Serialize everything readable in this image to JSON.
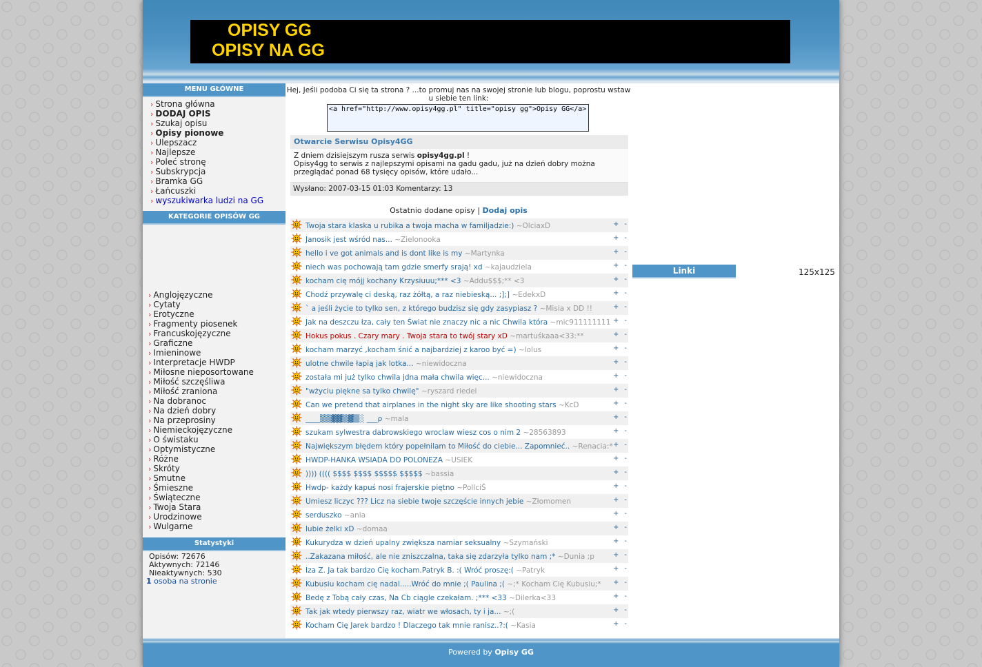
{
  "banner": {
    "line1": "OPISY GG",
    "line2": "OPISY NA GG"
  },
  "left": {
    "menu_title": "MENU GŁÓWNE",
    "menu": [
      {
        "label": "Strona główna",
        "style": ""
      },
      {
        "label": "DODAJ OPIS",
        "style": "bold"
      },
      {
        "label": "Szukaj opisu",
        "style": ""
      },
      {
        "label": "Opisy pionowe",
        "style": "bold"
      },
      {
        "label": "Ulepszacz",
        "style": ""
      },
      {
        "label": "Najlepsze",
        "style": ""
      },
      {
        "label": "Poleć stronę",
        "style": ""
      },
      {
        "label": "Subskrypcja",
        "style": ""
      },
      {
        "label": "Bramka GG",
        "style": ""
      },
      {
        "label": "Łańcuszki",
        "style": ""
      },
      {
        "label": "wyszukiwarka ludzi na GG",
        "style": "link"
      }
    ],
    "categories_title": "KATEGORIE OPISÓW GG",
    "categories": [
      "Anglojęzyczne",
      "Cytaty",
      "Erotyczne",
      "Fragmenty piosenek",
      "Francuskojęzyczne",
      "Graficzne",
      "Imieninowe",
      "Interpretacje HWDP",
      "Miłosne nieposortowane",
      "Miłość szczęśliwa",
      "Miłość zraniona",
      "Na dobranoc",
      "Na dzień dobry",
      "Na przeprosiny",
      "Niemieckojęzyczne",
      "O świstaku",
      "Optymistyczne",
      "Różne",
      "Skróty",
      "Smutne",
      "Śmieszne",
      "Świąteczne",
      "Twoja Stara",
      "Urodzinowe",
      "Wulgarne"
    ],
    "stats_title": "Statystyki",
    "stats": {
      "opisow": "Opisów: 72676",
      "aktywnych": "Aktywnych: 72146",
      "nieaktywnych": "Nieaktywnych: 530",
      "online_count": "1",
      "online_label": "osoba na stronie"
    }
  },
  "main": {
    "promo": "Hej, Jeśli podoba Ci się ta strona ? ...to promuj nas na swojej stronie lub blogu, poprostu wstaw u siebie ten link:",
    "promo_code": "<a href=\"http://www.opisy4gg.pl\" title=\"opisy gg\">Opisy GG</a>",
    "news": {
      "title": "Otwarcie Serwisu Opisy4GG",
      "body_prefix": "Z dniem dzisiejszym rusza serwis ",
      "body_bold": "opisy4gg.pl",
      "body_suffix": " !",
      "body_line2": "Opisy4gg to serwis z najlepszymi opisami na gadu gadu, już na dzień dobry można przeglądać ponad 68 tysięcy opisów, które udało...",
      "footer": "Wysłano: 2007-03-15 01:03 Komentarzy: 13"
    },
    "recent_label": "Ostatnio dodane opisy | ",
    "recent_link": "Dodaj opis",
    "plus": "+",
    "minus": "-",
    "entries": [
      {
        "text": "Twoja stara klaska u rubika a twoja macha w familjadzie:)",
        "author": "~OlciaxD"
      },
      {
        "text": "Janosik jest wśród nas...",
        "author": "~Zielonooka"
      },
      {
        "text": "hello i ve got animals and is dont like is my",
        "author": "~Martynka"
      },
      {
        "text": "niech was pochowają tam gdzie smerfy srają! xd",
        "author": "~kajaudziela"
      },
      {
        "text": "kocham cię mójj kochany Krzysiuuu;*** <3",
        "author": "~Addu$$$;** <3"
      },
      {
        "text": "Chodź przywalę ci deską, raz żółtą, a raz niebieską... ;];]",
        "author": "~EdekxD"
      },
      {
        "text": "` a jeśli życie to tylko sen, z którego budzisz się gdy zasypiasz ?",
        "author": "~Misia x DD !!"
      },
      {
        "text": "Jak na deszczu łza, cały ten Świat nie znaczy nic a nic Chwila która",
        "author": "~mic911111111"
      },
      {
        "text": "Hokus pokus . Czary mary . Twoja stara to twój stary xD",
        "author": "~martuśkaaa<33:**",
        "red": true
      },
      {
        "text": "kocham marzyć ,kocham śnić a najbardziej z karoo być =)",
        "author": "~lolus"
      },
      {
        "text": "ulotne chwile łapią jak lotka...",
        "author": "~niewidoczna"
      },
      {
        "text": "została mi już tylko chwila jdna mała chwila więc...",
        "author": "~niewidoczna"
      },
      {
        "text": "\"wżyciu piękne sa tylko chwilę\"",
        "author": "~ryszard riedel"
      },
      {
        "text": "Can we pretend that airplanes in the night sky are like shooting stars",
        "author": "~KcD"
      },
      {
        "text": "____▒▒▓▓▒▓▒░ ___ρ",
        "author": "~mala"
      },
      {
        "text": "szukam sylwestra dabrowskiego wroclaw wiesz cos o nim 2",
        "author": "~28563893"
      },
      {
        "text": "Największym błędem który popełnilam to Miłość do ciebie... Zapomnieć..",
        "author": "~Renacia:*"
      },
      {
        "text": "HWDP-HANKA WSIADA DO POLONEZA",
        "author": "~USIEK"
      },
      {
        "text": ")))) (((( $$$$ $$$$ $$$$$ $$$$$",
        "author": "~bassia"
      },
      {
        "text": "Hwdp- każdy kapuś nosi frajerskie piętno",
        "author": "~PollciŚ"
      },
      {
        "text": "Umiesz liczyc ??? Licz na siebie twoje szczęście innych jebie",
        "author": "~Złomomen"
      },
      {
        "text": "serduszko",
        "author": "~ania"
      },
      {
        "text": "lubie żelki xD",
        "author": "~domaa"
      },
      {
        "text": "Kukurydza w dzień upalny zwiększa namiar seksualny",
        "author": "~Szymański"
      },
      {
        "text": "..Zakazana miłość, ale nie zniszczalna, taka się zdarzyła tylko nam ;*",
        "author": "~Dunia ;p"
      },
      {
        "text": "Iza Z. Ja tak bardzo Cię kocham.Patryk B. :( Wróć proszę:(",
        "author": "~Patryk"
      },
      {
        "text": "Kubusiu kocham cię nadal.....Wróć do mnie ;( Paulina ;(",
        "author": "~;* Kocham Cię Kubusiu;*"
      },
      {
        "text": "Bedę z Tobą cały czas, Na Cb ciągle czekałam. ;*** <33",
        "author": "~Dilerka<33"
      },
      {
        "text": "Tak jak wtedy pierwszy raz, wiatr we włosach, ty i ja...",
        "author": "~;("
      },
      {
        "text": "Kocham Cię Jarek bardzo ! Dlaczego tak mnie ranisz..?:(",
        "author": "~Kasia"
      }
    ]
  },
  "right": {
    "links_title": "Linki",
    "ad_label": "125x125"
  },
  "footer": {
    "prefix": "Powered by ",
    "brand": "Opisy GG"
  },
  "colors": {
    "accent": "#4f95c8",
    "link": "#2a6aa0",
    "sun": "#ffb300"
  }
}
